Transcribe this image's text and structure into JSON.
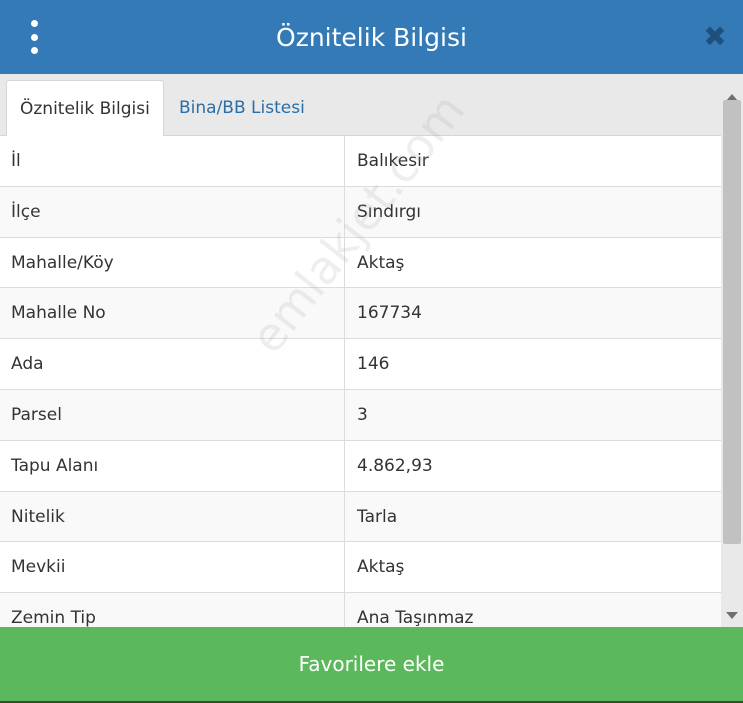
{
  "header": {
    "title": "Öznitelik Bilgisi",
    "close_glyph": "✖"
  },
  "tabs": [
    {
      "label": "Öznitelik Bilgisi",
      "active": true
    },
    {
      "label": "Bina/BB Listesi",
      "active": false
    }
  ],
  "attributes": [
    {
      "key": "İl",
      "value": "Balıkesir"
    },
    {
      "key": "İlçe",
      "value": "Sındırgı"
    },
    {
      "key": "Mahalle/Köy",
      "value": "Aktaş"
    },
    {
      "key": "Mahalle No",
      "value": "167734"
    },
    {
      "key": "Ada",
      "value": "146"
    },
    {
      "key": "Parsel",
      "value": "3"
    },
    {
      "key": "Tapu Alanı",
      "value": "4.862,93"
    },
    {
      "key": "Nitelik",
      "value": "Tarla"
    },
    {
      "key": "Mevkii",
      "value": "Aktaş"
    },
    {
      "key": "Zemin Tip",
      "value": "Ana Taşınmaz"
    }
  ],
  "watermark": "emlakjet.com",
  "footer": {
    "button_label": "Favorilere ekle"
  },
  "icons": {
    "menu": "vertical-dots-icon",
    "close": "close-icon"
  },
  "colors": {
    "header": "#337ab7",
    "footer": "#5cb85c",
    "link": "#2a6ea8"
  }
}
